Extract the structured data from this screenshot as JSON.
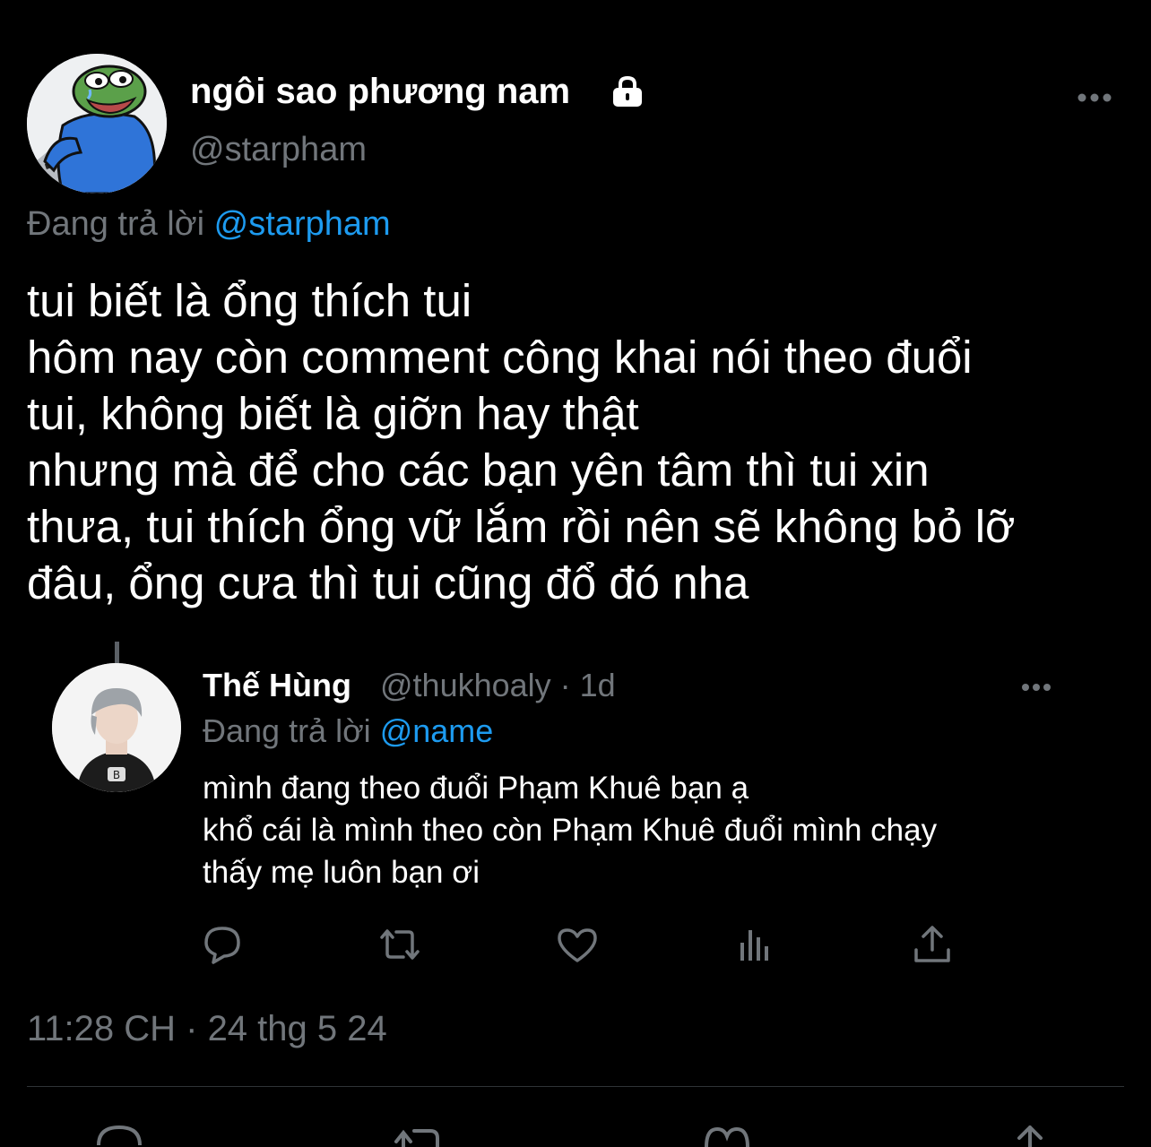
{
  "tweet": {
    "display_name": "ngôi sao phương nam",
    "lock_icon": "lock-icon",
    "handle": "@starpham",
    "replying_label": "Đang trả lời",
    "replying_mention": "@starpham",
    "lines": [
      "tui biết là ổng thích tui",
      "hôm nay còn comment công khai nói theo đuổi",
      "tui, không biết là giỡn hay thật",
      "nhưng mà để cho các bạn yên tâm thì tui xin",
      "thưa, tui thích ổng vữ lắm rồi nên sẽ không bỏ lỡ",
      "đâu, ổng cưa thì tui cũng đổ đó nha"
    ],
    "timestamp": "11:28 CH · 24 thg 5 24"
  },
  "quoted": {
    "display_name": "Thế Hùng",
    "meta": "@thukhoaly · 1d",
    "replying_label": "Đang trả lời",
    "replying_mention": "@name",
    "lines": [
      "mình đang theo đuổi Phạm Khuê bạn ạ",
      "khổ cái là mình theo còn Phạm Khuê đuổi mình chạy",
      "thấy mẹ luôn bạn ơi"
    ],
    "actions": [
      "reply-icon",
      "retweet-icon",
      "like-icon",
      "views-icon",
      "share-icon"
    ]
  },
  "bottom_actions": [
    "reply-icon",
    "retweet-icon",
    "like-icon",
    "share-icon"
  ],
  "colors": {
    "background": "#000000",
    "text": "#ffffff",
    "muted": "#71767b",
    "accent": "#1d9bf0",
    "divider": "#2f3336"
  }
}
